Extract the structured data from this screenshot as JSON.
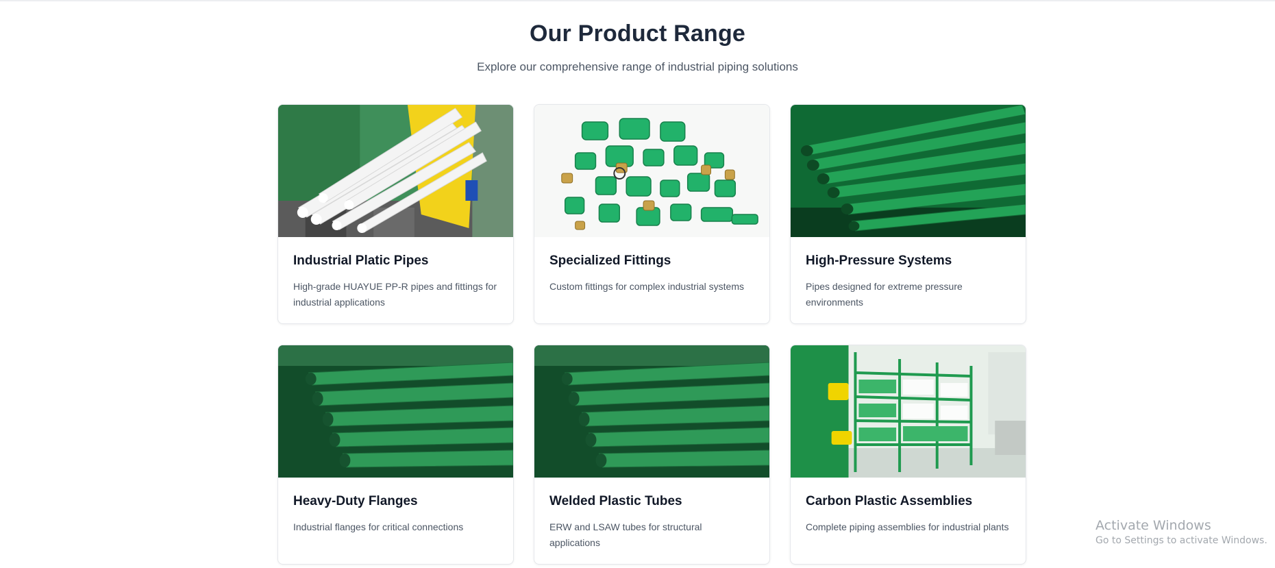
{
  "section": {
    "title": "Our Product Range",
    "subtitle": "Explore our comprehensive range of industrial piping solutions"
  },
  "products": [
    {
      "title": "Industrial Platic Pipes",
      "description": "High-grade HUAYUE PP-R pipes and fittings for industrial applications",
      "image": "white-pipes-photo"
    },
    {
      "title": "Specialized Fittings",
      "description": "Custom fittings for complex industrial systems",
      "image": "green-fittings-photo"
    },
    {
      "title": "High-Pressure Systems",
      "description": "Pipes designed for extreme pressure environments",
      "image": "green-pipes-photo"
    },
    {
      "title": "Heavy-Duty Flanges",
      "description": "Industrial flanges for critical connections",
      "image": "green-pipes-photo"
    },
    {
      "title": "Welded Plastic Tubes",
      "description": "ERW and LSAW tubes for structural applications",
      "image": "green-pipes-photo"
    },
    {
      "title": "Carbon Plastic Assemblies",
      "description": "Complete piping assemblies for industrial plants",
      "image": "warehouse-shelves-photo"
    }
  ],
  "watermark": {
    "title": "Activate Windows",
    "subtitle": "Go to Settings to activate Windows."
  },
  "colors": {
    "pipe_green": "#1f9a4f",
    "dark_green": "#0b4a25",
    "heading": "#1e293b"
  }
}
